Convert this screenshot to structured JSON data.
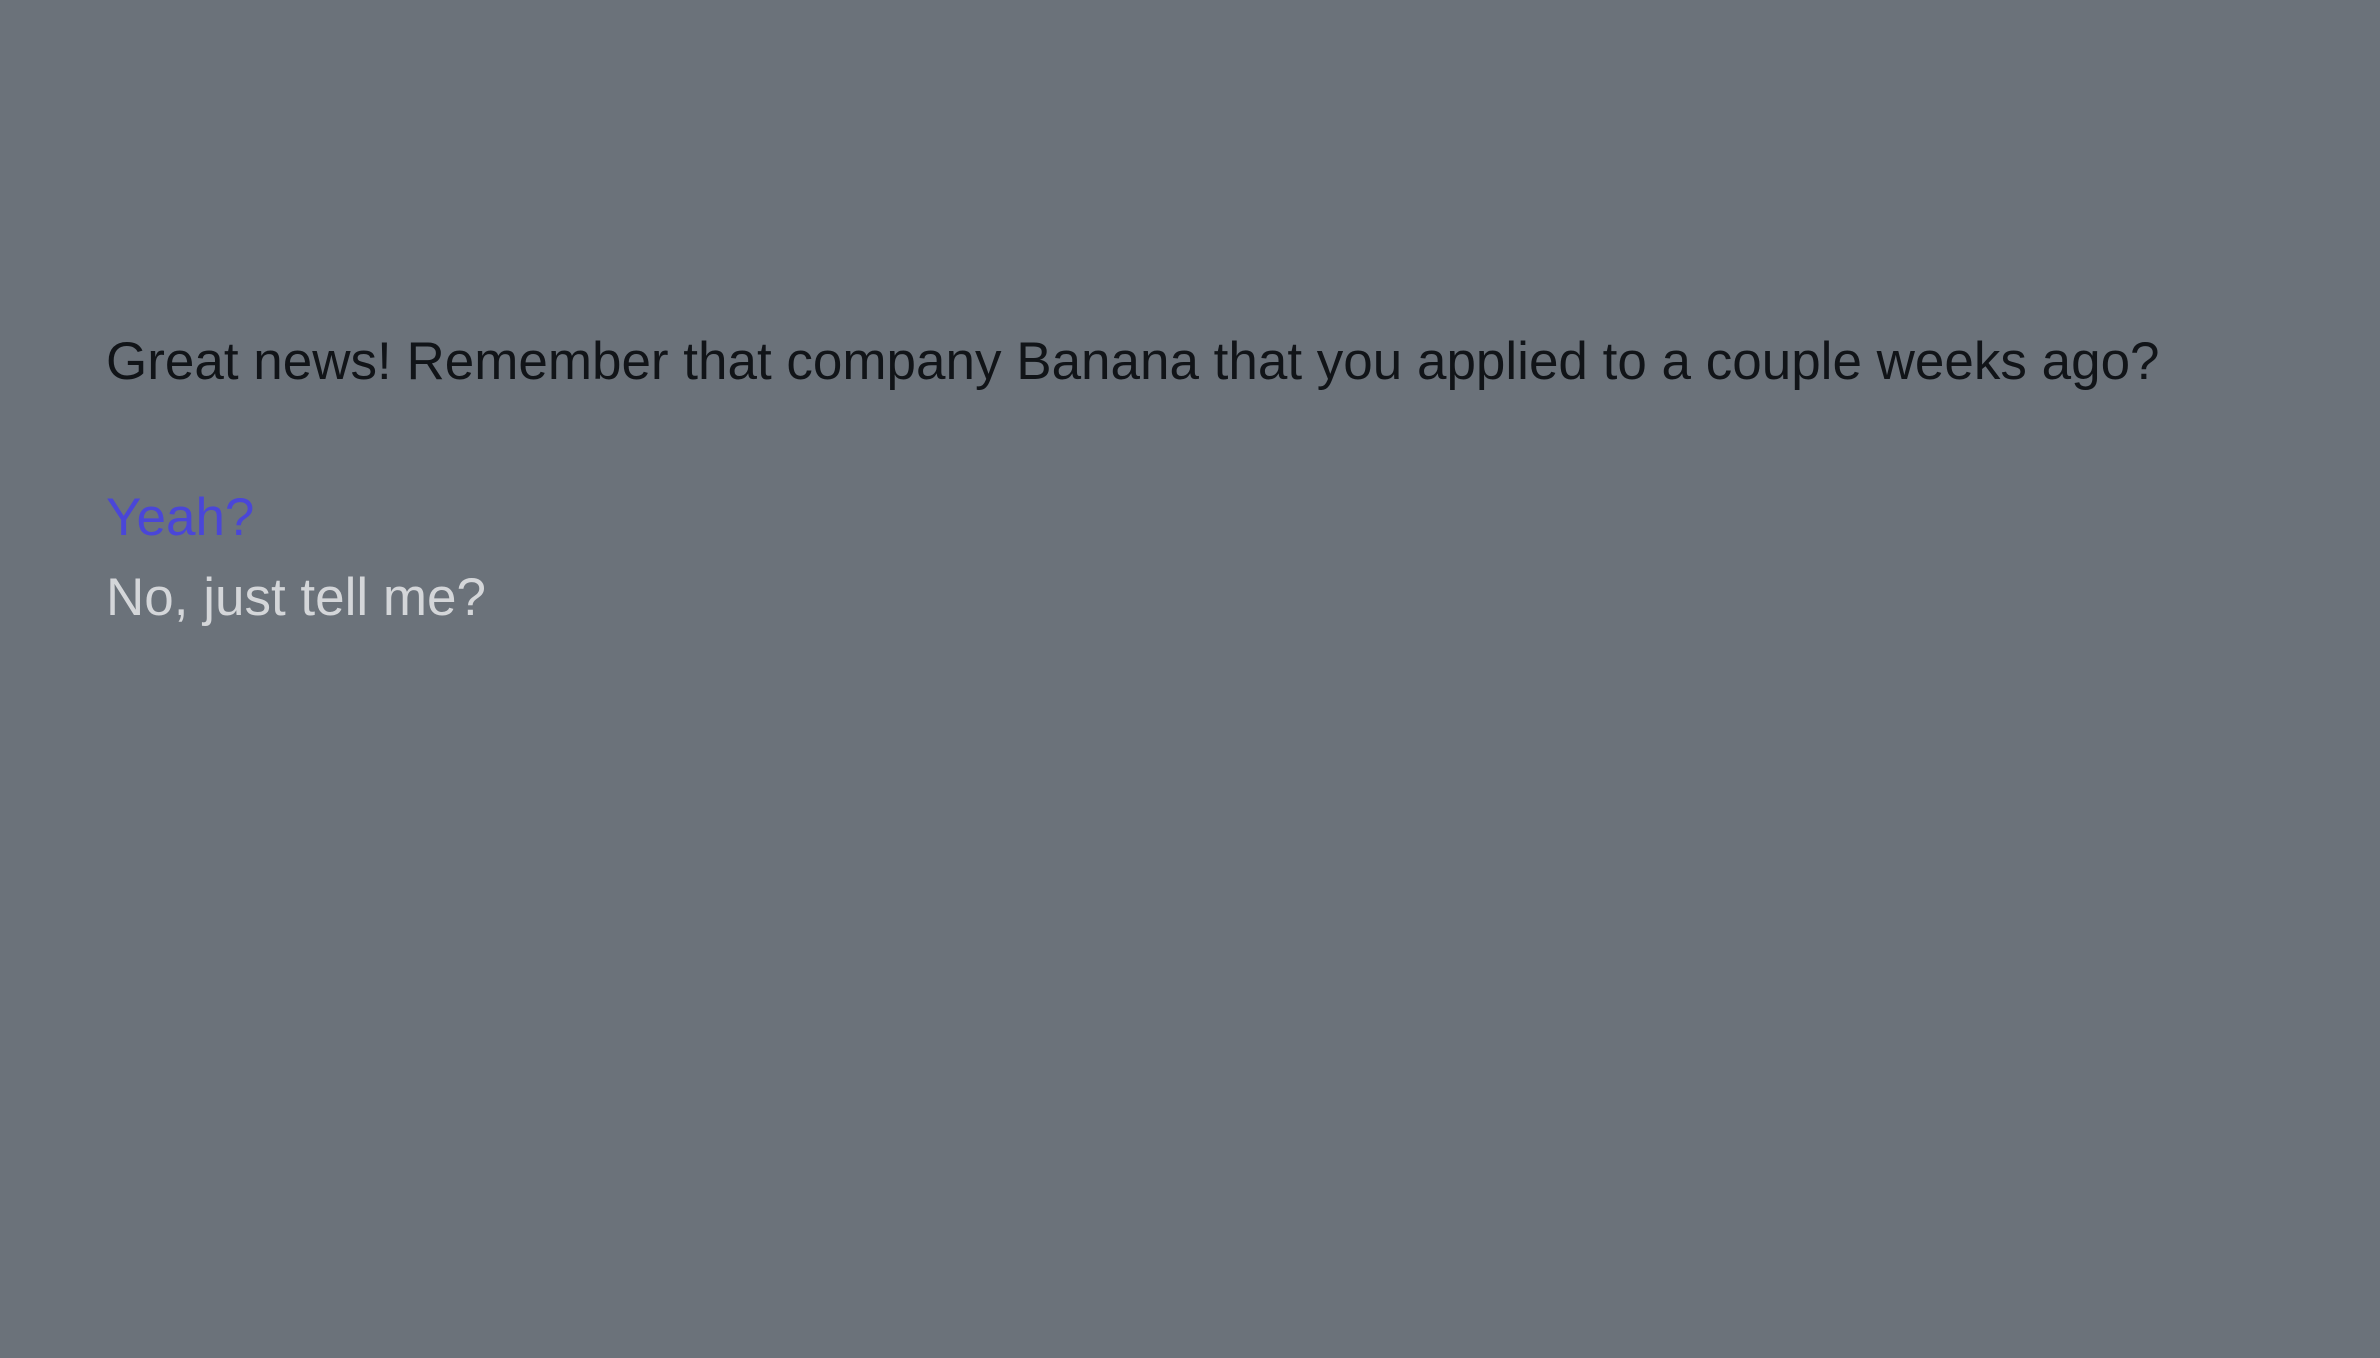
{
  "dialogue": {
    "line": "Great news! Remember that company Banana that you applied to a couple weeks ago?"
  },
  "choices": [
    {
      "label": "Yeah?",
      "selected": true
    },
    {
      "label": "No, just tell me?",
      "selected": false
    }
  ],
  "colors": {
    "background": "#6b727a",
    "dialogue_text": "#111418",
    "selected_choice": "#4a46d8",
    "unselected_choice": "#d4d6d9"
  }
}
